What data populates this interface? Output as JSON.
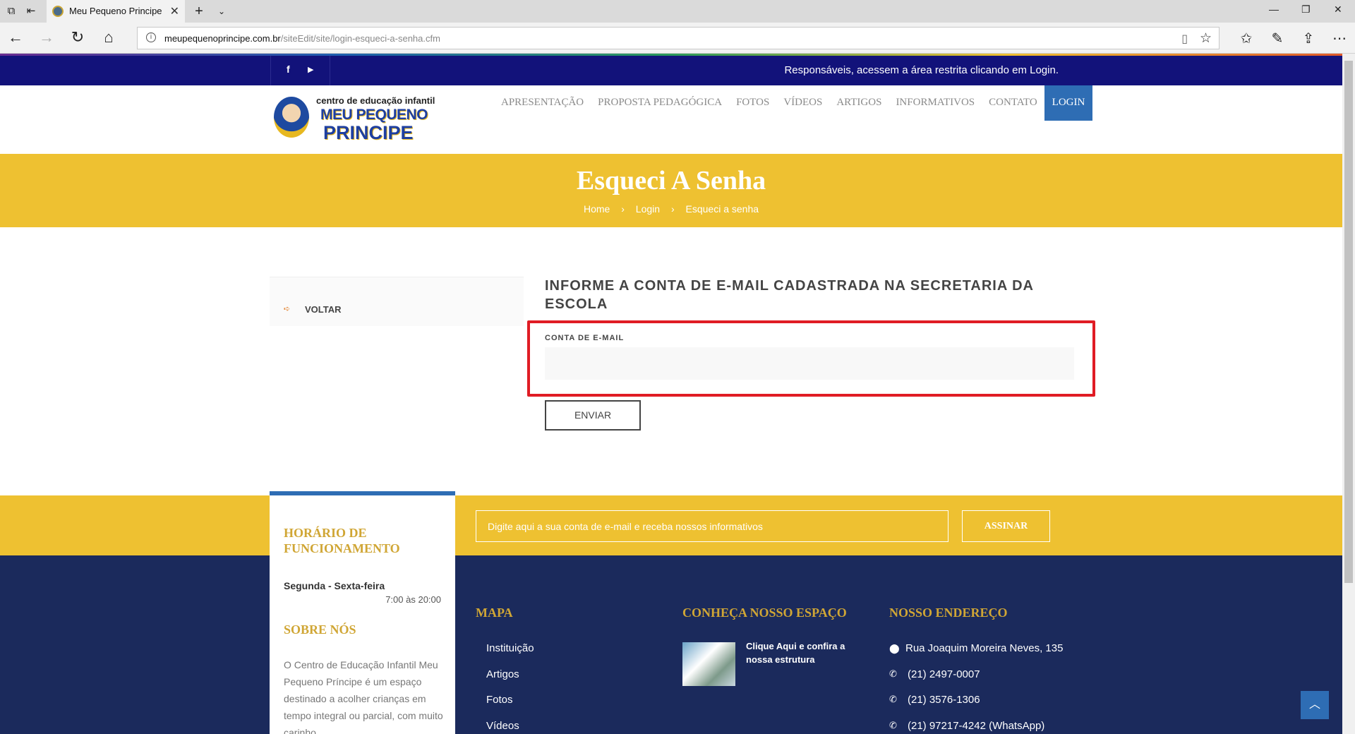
{
  "browser": {
    "tab_title": "Meu Pequeno Principe",
    "url_host": "meupequenoprincipe.com.br",
    "url_path": "/siteEdit/site/login-esqueci-a-senha.cfm"
  },
  "topbar": {
    "message": "Responsáveis, acessem a área restrita clicando em Login."
  },
  "logo": {
    "line1": "centro de educação infantil",
    "line2": "MEU PEQUENO",
    "line3": "PRINCIPE"
  },
  "menu": {
    "items": [
      "APRESENTAÇÃO",
      "PROPOSTA PEDAGÓGICA",
      "FOTOS",
      "VÍDEOS",
      "ARTIGOS",
      "INFORMATIVOS",
      "CONTATO",
      "LOGIN"
    ]
  },
  "page": {
    "title": "Esqueci A Senha",
    "breadcrumb": [
      "Home",
      "Login",
      "Esqueci a senha"
    ],
    "breadcrumb_sep": "›"
  },
  "sidebar": {
    "back_label": "VOLTAR"
  },
  "form": {
    "title": "INFORME A CONTA DE E-MAIL CADASTRADA NA SECRETARIA DA ESCOLA",
    "email_label": "CONTA DE E-MAIL",
    "email_value": "",
    "submit_label": "ENVIAR"
  },
  "footer": {
    "newsletter_placeholder": "Digite aqui a sua conta de e-mail e receba nossos informativos",
    "subscribe_label": "ASSINAR",
    "hours_title": "HORÁRIO DE FUNCIONAMENTO",
    "hours_days": "Segunda - Sexta-feira",
    "hours_time": "7:00 às 20:00",
    "about_title": "SOBRE NÓS",
    "about_text": "O Centro de Educação Infantil Meu Pequeno Príncipe é um espaço destinado a acolher crianças em tempo integral ou parcial, com muito carinho",
    "map_title": "MAPA",
    "map_links": [
      "Instituição",
      "Artigos",
      "Fotos",
      "Vídeos"
    ],
    "space_title": "CONHEÇA NOSSO ESPAÇO",
    "space_link": "Clique Aqui e confira a nossa estrutura",
    "address_title": "NOSSO ENDEREÇO",
    "address": "Rua Joaquim Moreira Neves, 135",
    "phone1": "(21) 2497-0007",
    "phone2": "(21) 3576-1306",
    "phone3": "(21) 97217-4242 (WhatsApp)"
  },
  "colors": {
    "topbar": "#12127a",
    "accent_yellow": "#eec131",
    "accent_blue": "#2e6db4",
    "footer_blue": "#1b2a5c",
    "highlight_red": "#e01c24"
  }
}
